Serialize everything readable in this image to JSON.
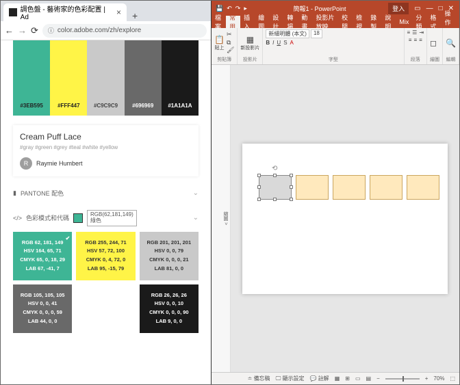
{
  "browser": {
    "tab_title": "調色盤 - 藝術家的色彩配置 | Ad",
    "url": "color.adobe.com/zh/explore"
  },
  "palette": {
    "swatches": [
      {
        "hex": "#3EB595"
      },
      {
        "hex": "#FFF447"
      },
      {
        "hex": "#C9C9C9"
      },
      {
        "hex": "#696969"
      },
      {
        "hex": "#1A1A1A"
      }
    ],
    "name": "Cream Puff Lace",
    "tags": "#gray #green #grey #teal #white #yellow",
    "author_initial": "R",
    "author_name": "Raymie Humbert"
  },
  "sections": {
    "pantone": "PANTONE 配色",
    "code": "色彩模式和代碼",
    "tooltip_rgb": "RGB(62,181,149)",
    "tooltip_label": "綠色"
  },
  "values": {
    "teal": {
      "rgb": "RGB 62, 181, 149",
      "hsv": "HSV 164, 65, 71",
      "cmyk": "CMYK 65, 0, 18, 29",
      "lab": "LAB 67, -41, 7"
    },
    "yellow": {
      "rgb": "RGB 255, 244, 71",
      "hsv": "HSV 57, 72, 100",
      "cmyk": "CMYK 0, 4, 72, 0",
      "lab": "LAB 95, -15, 79"
    },
    "lgray": {
      "rgb": "RGB 201, 201, 201",
      "hsv": "HSV 0, 0, 79",
      "cmyk": "CMYK 0, 0, 0, 21",
      "lab": "LAB 81, 0, 0"
    },
    "dgray": {
      "rgb": "RGB 105, 105, 105",
      "hsv": "HSV 0, 0, 41",
      "cmyk": "CMYK 0, 0, 0, 59",
      "lab": "LAB 44, 0, 0"
    },
    "black": {
      "rgb": "RGB 26, 26, 26",
      "hsv": "HSV 0, 0, 10",
      "cmyk": "CMYK 0, 0, 0, 90",
      "lab": "LAB 9, 0, 0"
    }
  },
  "pp": {
    "doc": "簡報1 - PowerPoint",
    "login": "登入",
    "tabs": {
      "file": "檔案",
      "home": "常用",
      "insert": "插入",
      "draw": "繪圖",
      "design": "設計",
      "trans": "轉場",
      "anim": "動畫",
      "slide": "投影片放映",
      "review": "校閱",
      "view": "檢視",
      "rec": "錄製",
      "help": "說明",
      "mix": "Mix",
      "cls": "分類",
      "fmt": "格式",
      "op": "操作說"
    },
    "groups": {
      "clipboard": "剪貼簿",
      "slides": "投影片",
      "font": "字型",
      "para": "段落",
      "draw": "繪圖",
      "edit": "編輯"
    },
    "btns": {
      "paste": "貼上",
      "newslide": "新投影片"
    },
    "font_name": "新細明體 (本文)",
    "font_size": "18",
    "outline": "縮圖",
    "status": {
      "notes": "備忘稿",
      "display": "顯示設定",
      "comments": "註解",
      "zoom": "70%"
    }
  }
}
